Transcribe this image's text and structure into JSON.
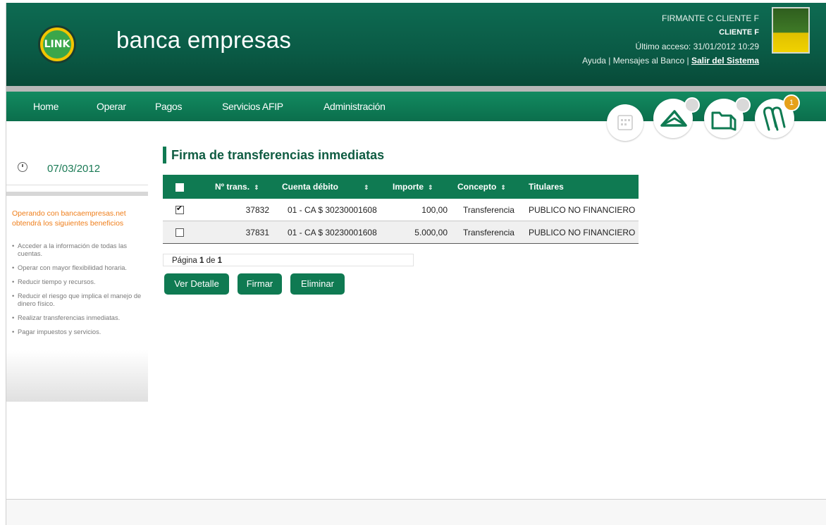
{
  "header": {
    "brand": "banca empresas",
    "logo_text": "LINK",
    "user_line1": "FIRMANTE C CLIENTE F",
    "user_line2": "CLIENTE F",
    "last_access": "Último acceso: 31/01/2012 10:29",
    "link_help": "Ayuda",
    "link_messages": "Mensajes al Banco",
    "link_logout": "Salir del Sistema",
    "separator": "|"
  },
  "nav": {
    "items": [
      "Home",
      "Operar",
      "Pagos",
      "Servicios AFIP",
      "Administración"
    ],
    "icons": [
      "calendar-icon",
      "envelope-icon",
      "folder-icon",
      "paperclip-icon"
    ],
    "badge_count": "1"
  },
  "sidebar": {
    "date": "07/03/2012",
    "title": "Operando con bancaempresas.net obtendrá los siguientes beneficios",
    "benefits": [
      "Acceder a la información de todas las cuentas.",
      "Operar con mayor flexibilidad horaria.",
      "Reducir tiempo y recursos.",
      "Reducir el riesgo que implica el manejo de dinero físico.",
      "Realizar transferencias inmediatas.",
      "Pagar impuestos y servicios."
    ]
  },
  "main": {
    "title": "Firma de transferencias inmediatas",
    "columns": [
      "Nº trans.",
      "Cuenta débito",
      "Importe",
      "Concepto",
      "Titulares"
    ],
    "sort_glyph": "⇕",
    "rows": [
      {
        "checked": true,
        "num": "37832",
        "account": "01 - CA $ 30230001608",
        "amount": "100,00",
        "concept": "Transferencia",
        "holders": "PUBLICO NO FINANCIERO"
      },
      {
        "checked": false,
        "num": "37831",
        "account": "01 - CA $ 30230001608",
        "amount": "5.000,00",
        "concept": "Transferencia",
        "holders": "PUBLICO NO FINANCIERO"
      }
    ],
    "pager": {
      "prefix": "Página",
      "current": "1",
      "of": "de",
      "total": "1"
    },
    "buttons": {
      "detail": "Ver Detalle",
      "sign": "Firmar",
      "delete": "Eliminar"
    }
  },
  "colors": {
    "primary_green": "#0f7a52",
    "header_green": "#0a5a45",
    "accent_orange": "#ef7e1a"
  }
}
